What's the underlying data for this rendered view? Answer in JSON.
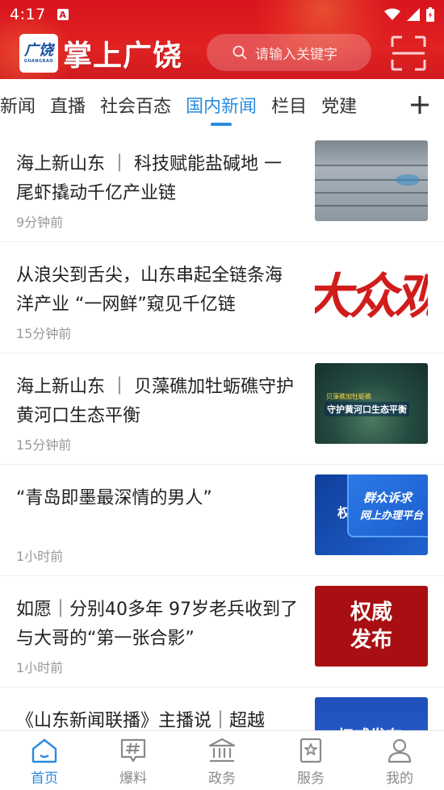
{
  "status_bar": {
    "time": "4:17",
    "notification": "A"
  },
  "header": {
    "logo_text": "广饶",
    "logo_sub": "GUANGRAO",
    "app_name": "掌上广饶",
    "search_placeholder": "请输入关键字"
  },
  "tabs": [
    {
      "label": "新闻"
    },
    {
      "label": "直播"
    },
    {
      "label": "社会百态"
    },
    {
      "label": "国内新闻",
      "active": true
    },
    {
      "label": "栏目"
    },
    {
      "label": "党建"
    }
  ],
  "news": [
    {
      "title": "海上新山东 ｜ 科技赋能盐碱地 一尾虾撬动千亿产业链",
      "time": "9分钟前",
      "thumb": "aquaculture-pond"
    },
    {
      "title": "从浪尖到舌尖，山东串起全链条海洋产业 “一网鲜”窥见千亿链",
      "time": "15分钟前",
      "thumb_text": "大众观"
    },
    {
      "title": "海上新山东 ｜ 贝藻礁加牡蛎礁守护黄河口生态平衡",
      "time": "15分钟前",
      "thumb_caption": "守护黄河口生态平衡",
      "thumb_caption_small": "贝藻礁加牡蛎礁"
    },
    {
      "title": "“青岛即墨最深情的男人”",
      "time": "1小时前",
      "thumb_line1": "群众诉求",
      "thumb_line2": "网上办理平台",
      "thumb_side": "权"
    },
    {
      "title": "如愿｜分别40多年 97岁老兵收到了与大哥的“第一张合影”",
      "time": "1小时前",
      "thumb_text": "权威发布"
    },
    {
      "title": "《山东新闻联播》主播说｜超越",
      "time": "",
      "thumb_text": "权威发布"
    }
  ],
  "bottom_nav": [
    {
      "label": "首页",
      "icon": "home-icon",
      "active": true
    },
    {
      "label": "爆料",
      "icon": "hashtag-icon"
    },
    {
      "label": "政务",
      "icon": "government-icon"
    },
    {
      "label": "服务",
      "icon": "star-bookmark-icon"
    },
    {
      "label": "我的",
      "icon": "user-icon"
    }
  ],
  "colors": {
    "header_red": "#d8141e",
    "accent_blue": "#2a8be0"
  }
}
